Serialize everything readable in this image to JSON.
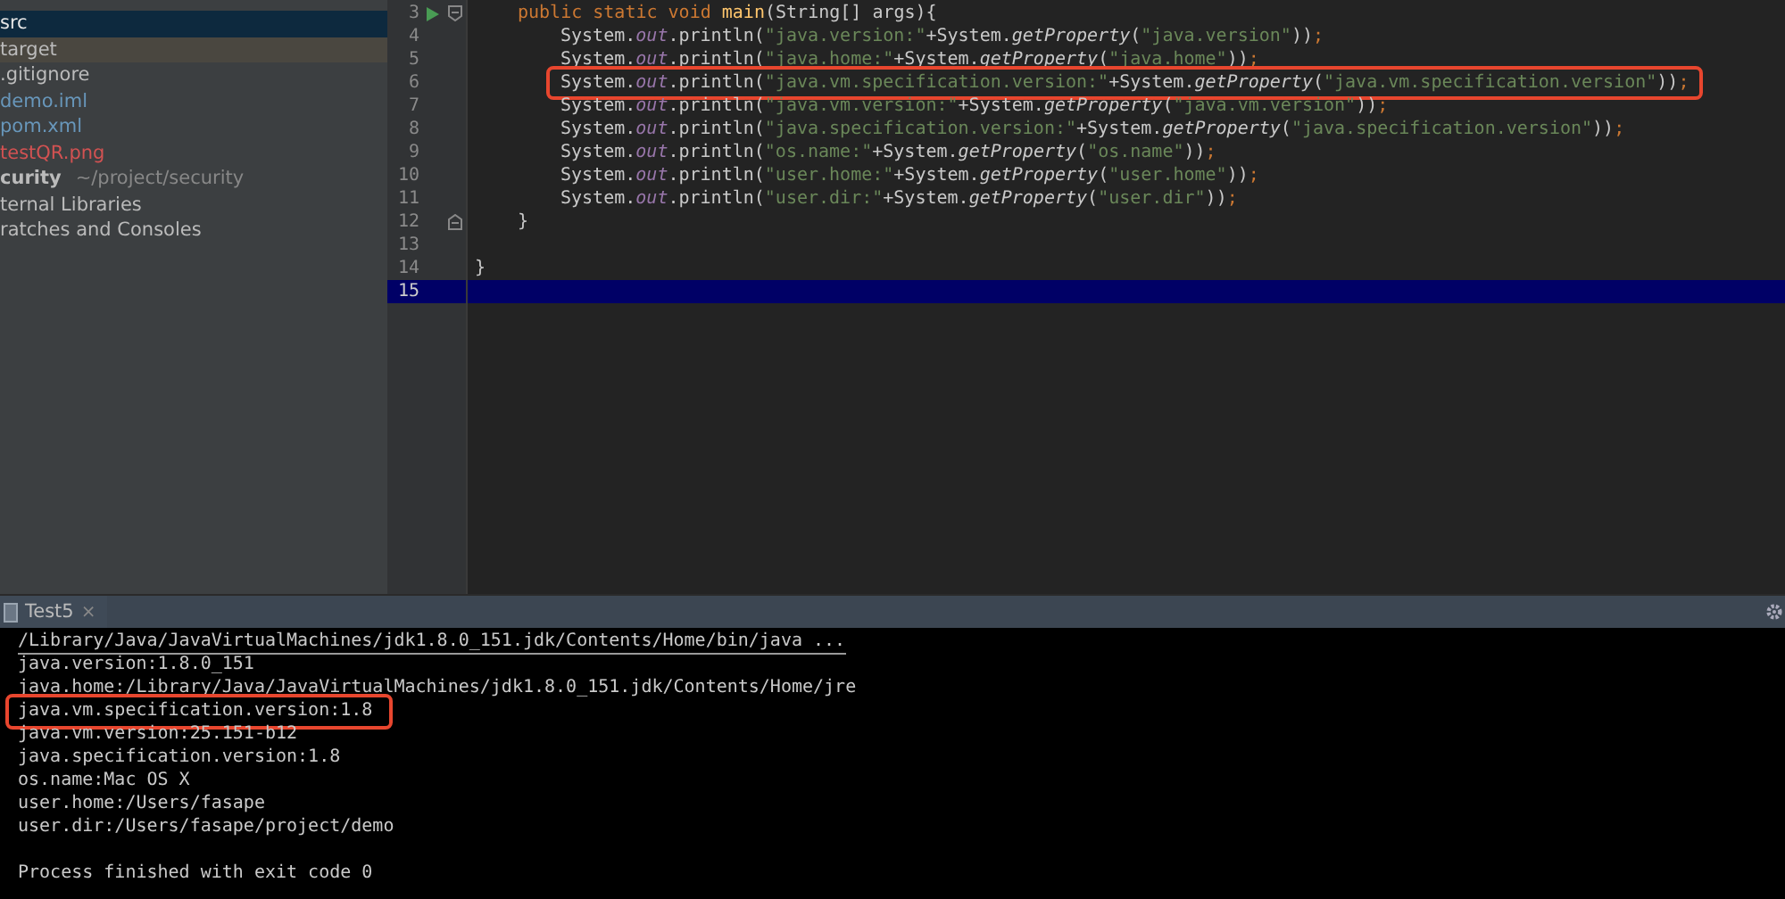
{
  "project_tree": {
    "items": [
      {
        "label": "src",
        "kind": "folder",
        "selected": true
      },
      {
        "label": "target",
        "kind": "excluded-folder",
        "selected": false,
        "color": "#bbbbbb"
      },
      {
        "label": ".gitignore",
        "kind": "file",
        "selected": false,
        "color": "#bbbbbb"
      },
      {
        "label": "demo.iml",
        "kind": "file",
        "selected": false,
        "color": "#6897bb"
      },
      {
        "label": "pom.xml",
        "kind": "file",
        "selected": false,
        "color": "#6897bb"
      },
      {
        "label": "testQR.png",
        "kind": "file",
        "selected": false,
        "color": "#d25252"
      },
      {
        "label": "curity",
        "path": "~/project/security",
        "kind": "module",
        "selected": false,
        "color": "#bbbbbb"
      },
      {
        "label": "ternal Libraries",
        "kind": "node",
        "selected": false,
        "color": "#bbbbbb"
      },
      {
        "label": "ratches and Consoles",
        "kind": "node",
        "selected": false,
        "color": "#bbbbbb"
      }
    ]
  },
  "editor": {
    "lines": [
      {
        "number": "3",
        "run_marker": true,
        "fold_open": true,
        "fold_close": false,
        "current": false,
        "boxed": false,
        "indent_class": true,
        "indent_method": false,
        "tokens": [
          {
            "kind": "keyword",
            "text": "public static void "
          },
          {
            "kind": "method",
            "text": "main"
          },
          {
            "kind": "plain",
            "text": "(String[] args){"
          }
        ]
      },
      {
        "number": "4",
        "run_marker": false,
        "fold_open": false,
        "fold_close": false,
        "current": false,
        "boxed": false,
        "indent_class": true,
        "indent_method": true,
        "tokens": [
          {
            "kind": "plain",
            "text": "System."
          },
          {
            "kind": "field",
            "text": "out"
          },
          {
            "kind": "plain",
            "text": ".println("
          },
          {
            "kind": "string",
            "text": "\"java.version:\""
          },
          {
            "kind": "plain",
            "text": "+System."
          },
          {
            "kind": "static",
            "text": "getProperty"
          },
          {
            "kind": "plain",
            "text": "("
          },
          {
            "kind": "string",
            "text": "\"java.version\""
          },
          {
            "kind": "plain",
            "text": "))"
          },
          {
            "kind": "semi",
            "text": ";"
          }
        ]
      },
      {
        "number": "5",
        "run_marker": false,
        "fold_open": false,
        "fold_close": false,
        "current": false,
        "boxed": false,
        "indent_class": true,
        "indent_method": true,
        "tokens": [
          {
            "kind": "plain",
            "text": "System."
          },
          {
            "kind": "field",
            "text": "out"
          },
          {
            "kind": "plain",
            "text": ".println("
          },
          {
            "kind": "string",
            "text": "\"java.home:\""
          },
          {
            "kind": "plain",
            "text": "+System."
          },
          {
            "kind": "static",
            "text": "getProperty"
          },
          {
            "kind": "plain",
            "text": "("
          },
          {
            "kind": "string",
            "text": "\"java.home\""
          },
          {
            "kind": "plain",
            "text": "))"
          },
          {
            "kind": "semi",
            "text": ";"
          }
        ]
      },
      {
        "number": "6",
        "run_marker": false,
        "fold_open": false,
        "fold_close": false,
        "current": false,
        "boxed": true,
        "indent_class": true,
        "indent_method": true,
        "tokens": [
          {
            "kind": "plain",
            "text": "System."
          },
          {
            "kind": "field",
            "text": "out"
          },
          {
            "kind": "plain",
            "text": ".println("
          },
          {
            "kind": "string",
            "text": "\"java.vm.specification.version:\""
          },
          {
            "kind": "plain",
            "text": "+System."
          },
          {
            "kind": "static",
            "text": "getProperty"
          },
          {
            "kind": "plain",
            "text": "("
          },
          {
            "kind": "string",
            "text": "\"java.vm.specification.version\""
          },
          {
            "kind": "plain",
            "text": "))"
          },
          {
            "kind": "semi",
            "text": ";"
          }
        ]
      },
      {
        "number": "7",
        "run_marker": false,
        "fold_open": false,
        "fold_close": false,
        "current": false,
        "boxed": false,
        "indent_class": true,
        "indent_method": true,
        "tokens": [
          {
            "kind": "plain",
            "text": "System."
          },
          {
            "kind": "field",
            "text": "out"
          },
          {
            "kind": "plain",
            "text": ".println("
          },
          {
            "kind": "string",
            "text": "\"java.vm.version:\""
          },
          {
            "kind": "plain",
            "text": "+System."
          },
          {
            "kind": "static",
            "text": "getProperty"
          },
          {
            "kind": "plain",
            "text": "("
          },
          {
            "kind": "string",
            "text": "\"java.vm.version\""
          },
          {
            "kind": "plain",
            "text": "))"
          },
          {
            "kind": "semi",
            "text": ";"
          }
        ]
      },
      {
        "number": "8",
        "run_marker": false,
        "fold_open": false,
        "fold_close": false,
        "current": false,
        "boxed": false,
        "indent_class": true,
        "indent_method": true,
        "tokens": [
          {
            "kind": "plain",
            "text": "System."
          },
          {
            "kind": "field",
            "text": "out"
          },
          {
            "kind": "plain",
            "text": ".println("
          },
          {
            "kind": "string",
            "text": "\"java.specification.version:\""
          },
          {
            "kind": "plain",
            "text": "+System."
          },
          {
            "kind": "static",
            "text": "getProperty"
          },
          {
            "kind": "plain",
            "text": "("
          },
          {
            "kind": "string",
            "text": "\"java.specification.version\""
          },
          {
            "kind": "plain",
            "text": "))"
          },
          {
            "kind": "semi",
            "text": ";"
          }
        ]
      },
      {
        "number": "9",
        "run_marker": false,
        "fold_open": false,
        "fold_close": false,
        "current": false,
        "boxed": false,
        "indent_class": true,
        "indent_method": true,
        "tokens": [
          {
            "kind": "plain",
            "text": "System."
          },
          {
            "kind": "field",
            "text": "out"
          },
          {
            "kind": "plain",
            "text": ".println("
          },
          {
            "kind": "string",
            "text": "\"os.name:\""
          },
          {
            "kind": "plain",
            "text": "+System."
          },
          {
            "kind": "static",
            "text": "getProperty"
          },
          {
            "kind": "plain",
            "text": "("
          },
          {
            "kind": "string",
            "text": "\"os.name\""
          },
          {
            "kind": "plain",
            "text": "))"
          },
          {
            "kind": "semi",
            "text": ";"
          }
        ]
      },
      {
        "number": "10",
        "run_marker": false,
        "fold_open": false,
        "fold_close": false,
        "current": false,
        "boxed": false,
        "indent_class": true,
        "indent_method": true,
        "tokens": [
          {
            "kind": "plain",
            "text": "System."
          },
          {
            "kind": "field",
            "text": "out"
          },
          {
            "kind": "plain",
            "text": ".println("
          },
          {
            "kind": "string",
            "text": "\"user.home:\""
          },
          {
            "kind": "plain",
            "text": "+System."
          },
          {
            "kind": "static",
            "text": "getProperty"
          },
          {
            "kind": "plain",
            "text": "("
          },
          {
            "kind": "string",
            "text": "\"user.home\""
          },
          {
            "kind": "plain",
            "text": "))"
          },
          {
            "kind": "semi",
            "text": ";"
          }
        ]
      },
      {
        "number": "11",
        "run_marker": false,
        "fold_open": false,
        "fold_close": false,
        "current": false,
        "boxed": false,
        "indent_class": true,
        "indent_method": true,
        "tokens": [
          {
            "kind": "plain",
            "text": "System."
          },
          {
            "kind": "field",
            "text": "out"
          },
          {
            "kind": "plain",
            "text": ".println("
          },
          {
            "kind": "string",
            "text": "\"user.dir:\""
          },
          {
            "kind": "plain",
            "text": "+System."
          },
          {
            "kind": "static",
            "text": "getProperty"
          },
          {
            "kind": "plain",
            "text": "("
          },
          {
            "kind": "string",
            "text": "\"user.dir\""
          },
          {
            "kind": "plain",
            "text": "))"
          },
          {
            "kind": "semi",
            "text": ";"
          }
        ]
      },
      {
        "number": "12",
        "run_marker": false,
        "fold_open": false,
        "fold_close": true,
        "current": false,
        "boxed": false,
        "indent_class": true,
        "indent_method": false,
        "tokens": [
          {
            "kind": "plain",
            "text": "}"
          }
        ]
      },
      {
        "number": "13",
        "run_marker": false,
        "fold_open": false,
        "fold_close": false,
        "current": false,
        "boxed": false
      },
      {
        "number": "14",
        "run_marker": false,
        "fold_open": false,
        "fold_close": false,
        "current": false,
        "boxed": false,
        "indent_class": false,
        "indent_method": false,
        "tokens": [
          {
            "kind": "plain",
            "text": "}"
          }
        ]
      },
      {
        "number": "15",
        "run_marker": false,
        "fold_open": false,
        "fold_close": false,
        "current": true,
        "boxed": false
      }
    ]
  },
  "run_panel": {
    "tabs": [
      {
        "label": "Test5",
        "selected": true,
        "closable": "×"
      }
    ],
    "lines": [
      {
        "kind": "command",
        "boxed": false,
        "text": "/Library/Java/JavaVirtualMachines/jdk1.8.0_151.jdk/Contents/Home/bin/java ..."
      },
      {
        "kind": "output",
        "boxed": false,
        "text": "java.version:1.8.0_151"
      },
      {
        "kind": "output",
        "boxed": false,
        "text": "java.home:/Library/Java/JavaVirtualMachines/jdk1.8.0_151.jdk/Contents/Home/jre"
      },
      {
        "kind": "output",
        "boxed": true,
        "text": "java.vm.specification.version:1.8"
      },
      {
        "kind": "output",
        "boxed": false,
        "text": "java.vm.version:25.151-b12"
      },
      {
        "kind": "output",
        "boxed": false,
        "text": "java.specification.version:1.8"
      },
      {
        "kind": "output",
        "boxed": false,
        "text": "os.name:Mac OS X"
      },
      {
        "kind": "output",
        "boxed": false,
        "text": "user.home:/Users/fasape"
      },
      {
        "kind": "output",
        "boxed": false,
        "text": "user.dir:/Users/fasape/project/demo"
      },
      {
        "kind": "exit",
        "boxed": false,
        "text": "Process finished with exit code 0"
      }
    ]
  }
}
